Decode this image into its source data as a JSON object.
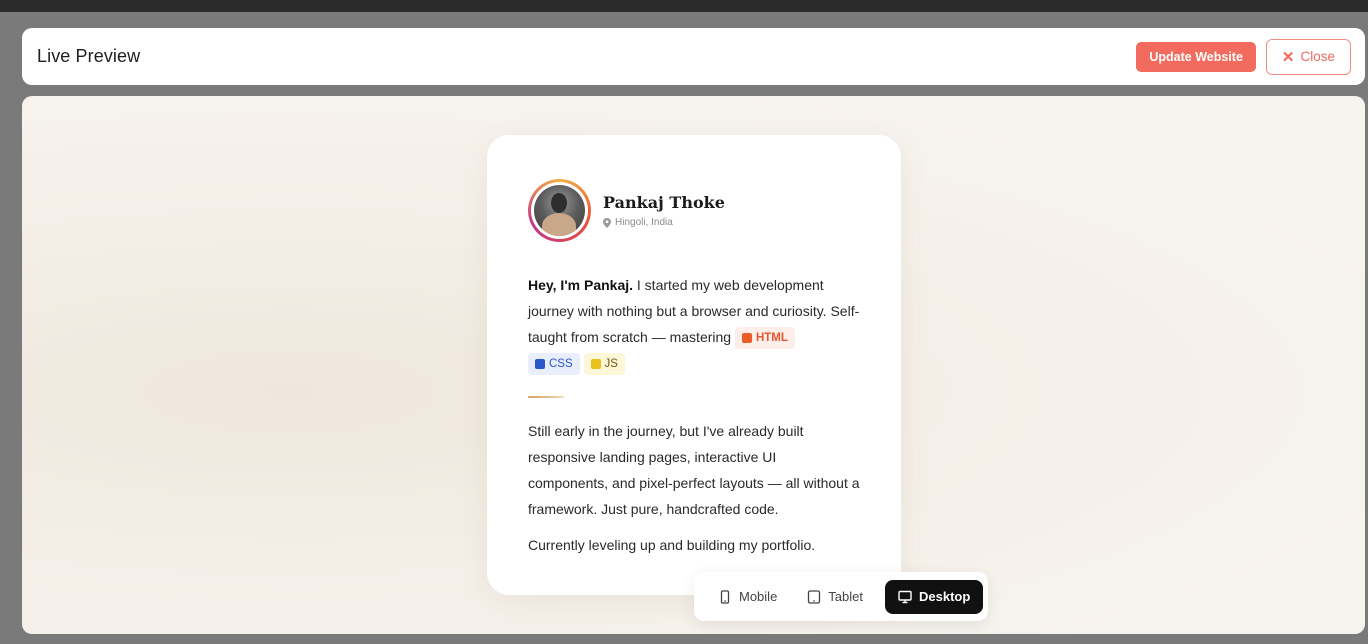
{
  "header": {
    "title": "Live Preview",
    "update_label": "Update Website",
    "close_label": "Close",
    "close_icon": "✕"
  },
  "profile": {
    "name": "Pankaj Thoke",
    "location": "Hingoli, India",
    "avatar_icon": "profile-photo"
  },
  "bio": {
    "intro_bold": "Hey, I'm Pankaj.",
    "intro_text": " I started my web development journey with nothing but a browser and curiosity. Self-taught from scratch — mastering ",
    "tags": [
      "HTML",
      "CSS",
      "JS"
    ],
    "paragraph2": "Still early in the journey, but I've already built responsive landing pages, interactive UI components, and pixel-perfect layouts — all without a framework. Just pure, handcrafted code.",
    "paragraph3": "Currently leveling up and building my portfolio."
  },
  "devices": {
    "mobile": "Mobile",
    "tablet": "Tablet",
    "desktop": "Desktop",
    "active": "Desktop"
  },
  "colors": {
    "accent": "#f26b5e",
    "html_tag": "#e85d2a",
    "css_tag": "#2a57c9",
    "js_tag": "#e8c21c"
  }
}
